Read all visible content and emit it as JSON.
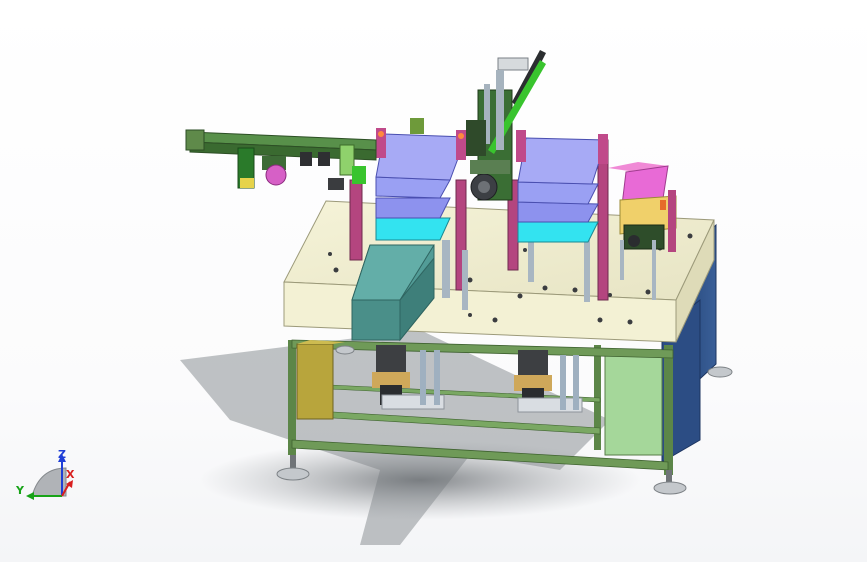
{
  "window": {
    "title": ""
  },
  "viewport": {
    "background": "#ffffff"
  },
  "triad": {
    "z_label": "Z",
    "y_label": "Y",
    "x_label": "X",
    "z_color": "#1f3fd6",
    "y_color": "#17a317",
    "x_color": "#d81f1f"
  },
  "palette": {
    "tabletop": "#f0eed0",
    "frame": "#5f8a4a",
    "panel_blue": "#2e4f86",
    "tray_lavender": "#9a9df0",
    "tray_cyan": "#33e3f0",
    "post_magenta": "#b0407a",
    "hopper_teal": "#4c9a96",
    "pink_module": "#e86ad6",
    "green_accent": "#39c42e",
    "shadow": "#8b8f93"
  },
  "model": {
    "name": "assembly-3d-model"
  }
}
